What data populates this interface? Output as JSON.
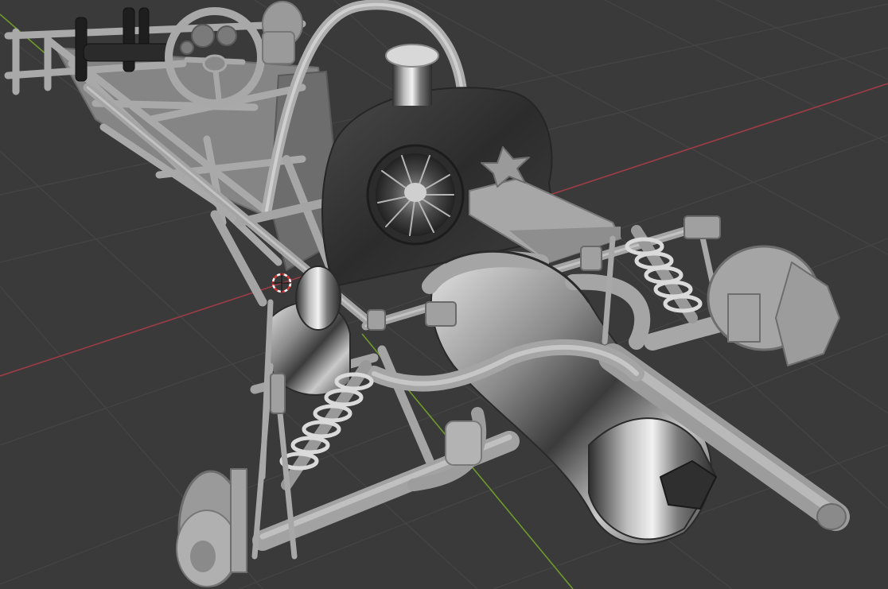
{
  "viewport": {
    "background": "#3a3a3a",
    "grid_color": "#454545",
    "x_axis_color": "#9e3c46",
    "y_axis_color": "#6f9a2b",
    "cursor_colors": [
      "#d83a3a",
      "#ffffff"
    ],
    "shading": "solid",
    "object": "buggy-chassis-model"
  }
}
